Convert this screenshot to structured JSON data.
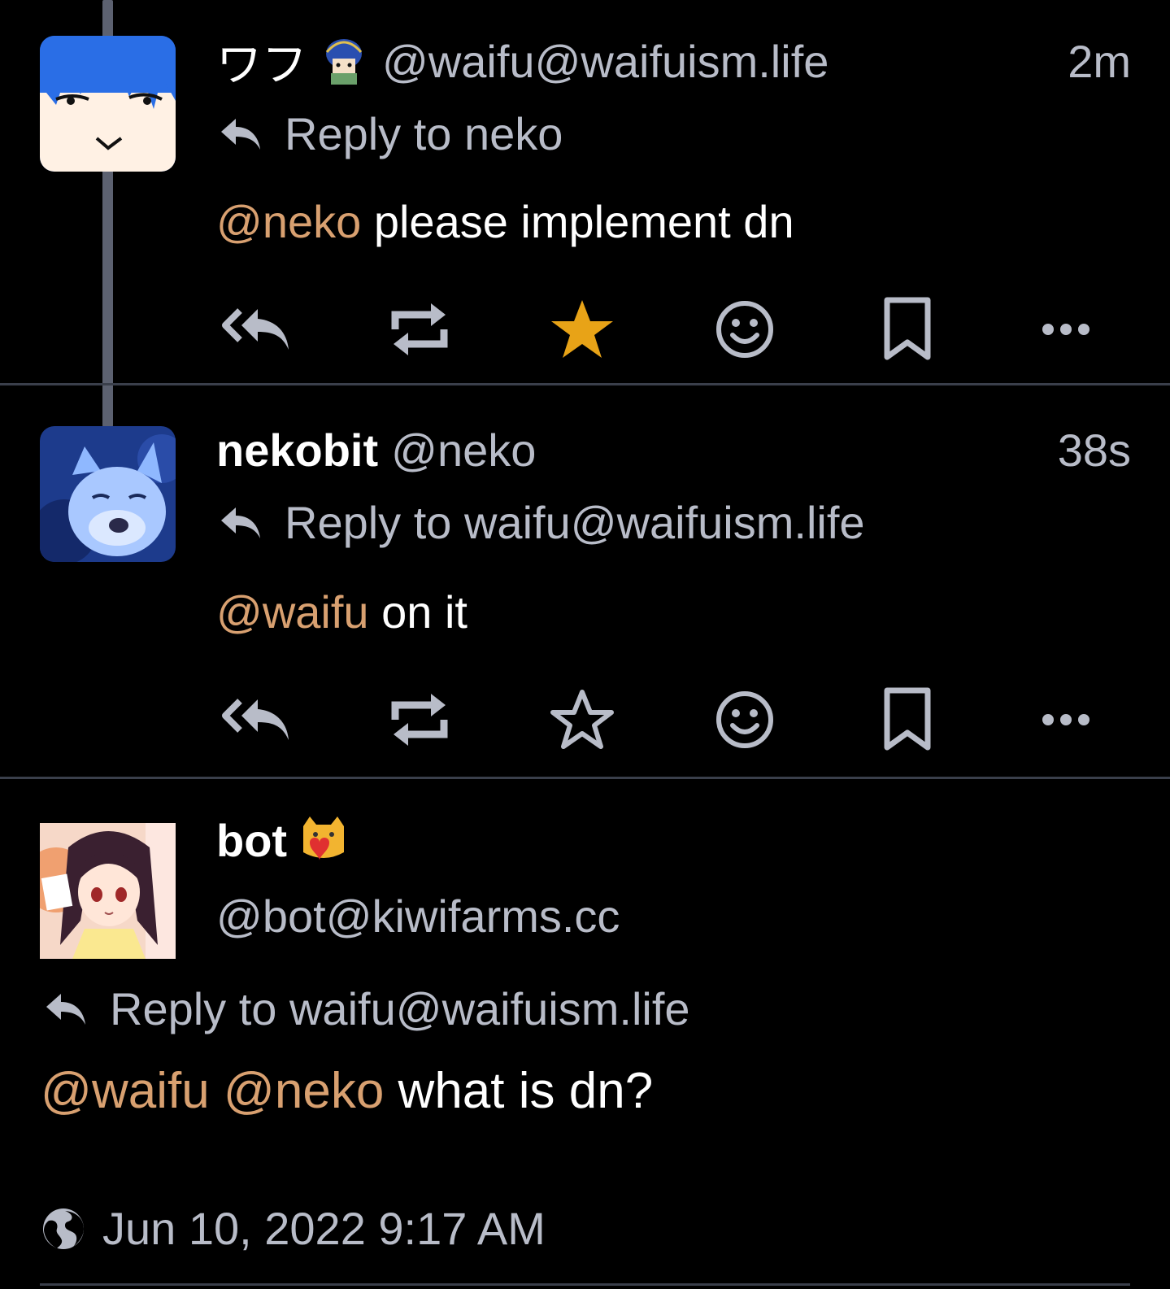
{
  "posts": [
    {
      "display_name": "ワフ",
      "handle": "@waifu@waifuism.life",
      "time": "2m",
      "reply_to": "Reply to neko",
      "mention": "@neko",
      "text": " please implement dn",
      "favorited": true
    },
    {
      "display_name": "nekobit",
      "handle": "@neko",
      "time": "38s",
      "reply_to": "Reply to waifu@waifuism.life",
      "mention": "@waifu",
      "text": " on it",
      "favorited": false
    },
    {
      "display_name": "bot",
      "handle": "@bot@kiwifarms.cc",
      "reply_to": "Reply to waifu@waifuism.life",
      "mention1": "@waifu",
      "mention2": "@neko",
      "text": " what is dn?",
      "timestamp": "Jun 10, 2022 9:17 AM"
    }
  ],
  "colors": {
    "background": "#000000",
    "mention": "#d8a070",
    "favorite_active": "#e8a317",
    "muted_text": "#b8bcc8",
    "thread_line": "#5c6170",
    "divider": "#3a3f4b"
  },
  "icons": {
    "reply_all": "reply-all-icon",
    "boost": "repeat-icon",
    "favorite": "star-icon",
    "react": "smile-icon",
    "bookmark": "bookmark-icon",
    "more": "more-icon",
    "reply": "reply-icon",
    "visibility": "globe-icon"
  }
}
